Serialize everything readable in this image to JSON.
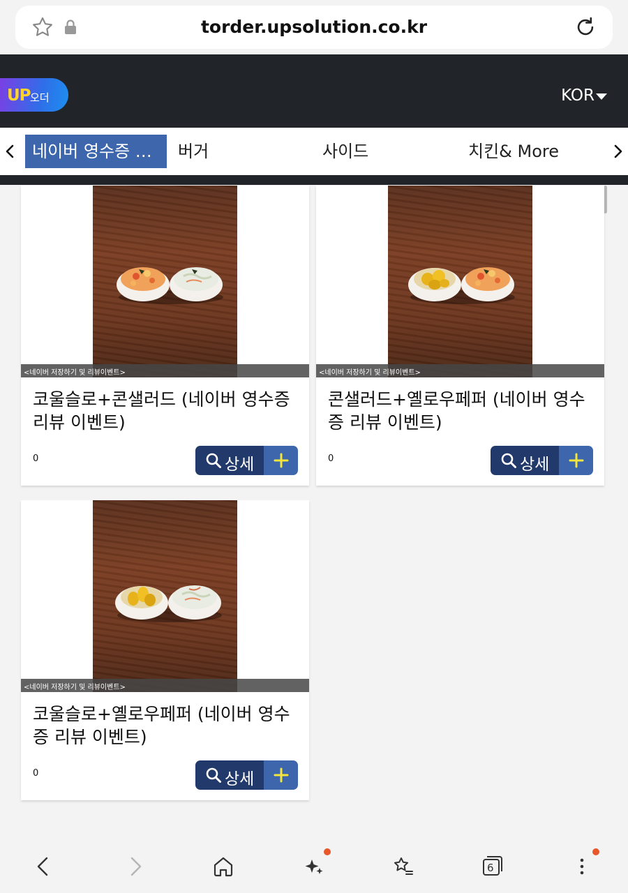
{
  "browser": {
    "url": "torder.upsolution.co.kr",
    "tab_count": "6"
  },
  "header": {
    "logo_up": "UP",
    "logo_sub": "오더",
    "language": "KOR"
  },
  "categories": [
    {
      "label": "네이버 영수증 …",
      "active": true
    },
    {
      "label": "버거",
      "active": false
    },
    {
      "label": "사이드",
      "active": false
    },
    {
      "label": "치킨& More",
      "active": false
    }
  ],
  "products": [
    {
      "caption": "<네이버 저장하기 및 리뷰이벤트>",
      "name": "코울슬로+콘샐러드 (네이버 영수증 리뷰 이벤트)",
      "price": "0",
      "detail_label": "상세"
    },
    {
      "caption": "<네이버 저장하기 및 리뷰이벤트>",
      "name": "콘샐러드+옐로우페퍼 (네이버 영수증 리뷰 이벤트)",
      "price": "0",
      "detail_label": "상세"
    },
    {
      "caption": "<네이버 저장하기 및 리뷰이벤트>",
      "name": "코울슬로+옐로우페퍼 (네이버 영수증 리뷰 이벤트)",
      "price": "0",
      "detail_label": "상세"
    }
  ],
  "colors": {
    "header_bg": "#212529",
    "active_category": "#3d66ad",
    "detail_button": "#223a6b",
    "add_button": "#3d66ad",
    "add_icon": "#f5e63c",
    "notification_dot": "#e8572a"
  }
}
